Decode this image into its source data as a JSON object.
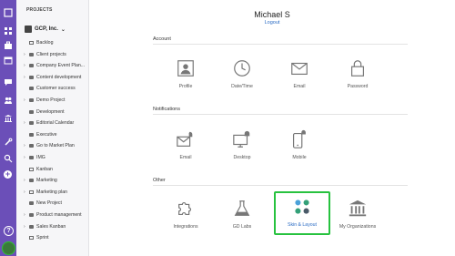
{
  "sidebar": {
    "heading": "PROJECTS",
    "company": "GCP, Inc.",
    "items": [
      {
        "label": "Backlog",
        "icon": "board",
        "arrow": false
      },
      {
        "label": "Client projects",
        "icon": "folder",
        "arrow": true
      },
      {
        "label": "Company Event Plan...",
        "icon": "folder",
        "arrow": true
      },
      {
        "label": "Content development",
        "icon": "folder",
        "arrow": true
      },
      {
        "label": "Customer success",
        "icon": "folder",
        "arrow": false
      },
      {
        "label": "Demo Project",
        "icon": "folder",
        "arrow": true
      },
      {
        "label": "Development",
        "icon": "folder",
        "arrow": false
      },
      {
        "label": "Editorial Calendar",
        "icon": "folder",
        "arrow": true
      },
      {
        "label": "Executive",
        "icon": "folder",
        "arrow": false
      },
      {
        "label": "Go to Market Plan",
        "icon": "folder",
        "arrow": true
      },
      {
        "label": "IMG",
        "icon": "folder",
        "arrow": true
      },
      {
        "label": "Kanban",
        "icon": "board",
        "arrow": false
      },
      {
        "label": "Marketing",
        "icon": "folder",
        "arrow": true
      },
      {
        "label": "Marketing plan",
        "icon": "board",
        "arrow": true
      },
      {
        "label": "New Project",
        "icon": "folder",
        "arrow": false
      },
      {
        "label": "Product management",
        "icon": "folder",
        "arrow": true
      },
      {
        "label": "Sales Kanban",
        "icon": "folder",
        "arrow": true
      },
      {
        "label": "Sprint",
        "icon": "board",
        "arrow": false
      }
    ]
  },
  "user": {
    "name": "Michael S",
    "logout": "Logout"
  },
  "sections": [
    {
      "title": "Account",
      "tiles": [
        {
          "label": "Profile",
          "icon": "profile-icon"
        },
        {
          "label": "Date/Time",
          "icon": "clock-icon"
        },
        {
          "label": "Email",
          "icon": "envelope-icon"
        },
        {
          "label": "Password",
          "icon": "lock-icon"
        }
      ]
    },
    {
      "title": "Notifications",
      "tiles": [
        {
          "label": "Email",
          "icon": "envelope-bell-icon"
        },
        {
          "label": "Desktop",
          "icon": "monitor-bell-icon"
        },
        {
          "label": "Mobile",
          "icon": "phone-bell-icon"
        }
      ]
    },
    {
      "title": "Other",
      "tiles": [
        {
          "label": "Integrations",
          "icon": "puzzle-icon"
        },
        {
          "label": "GD Labs",
          "icon": "flask-icon"
        },
        {
          "label": "Skin & Layout",
          "icon": "dots-icon",
          "selected": true
        },
        {
          "label": "My Organizations",
          "icon": "building-icon"
        }
      ]
    }
  ],
  "colors": {
    "rail": "#6b4fb8",
    "selected_border": "#27c23f",
    "link": "#2b6cc4"
  }
}
